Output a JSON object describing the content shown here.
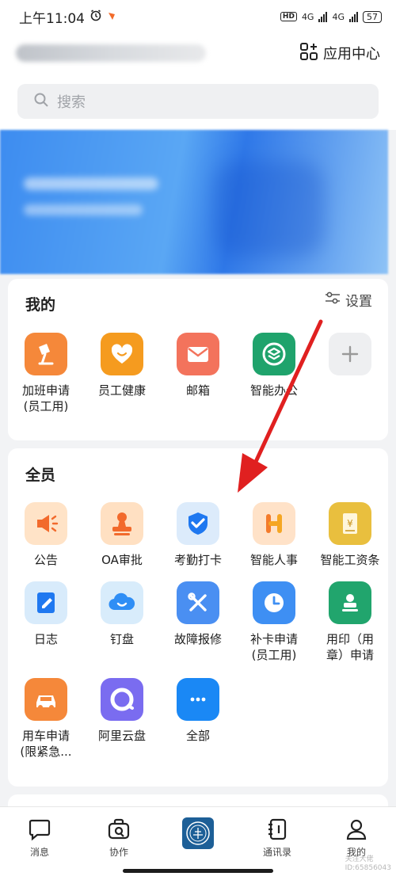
{
  "status_bar": {
    "time": "上午11:04",
    "network_1": "4G",
    "network_2": "4G",
    "hd": "HD",
    "battery": "57"
  },
  "header": {
    "app_center": "应用中心"
  },
  "search": {
    "placeholder": "搜索"
  },
  "my_section": {
    "title": "我的",
    "settings": "设置",
    "apps": [
      {
        "label": "加班申请\n(员工用)",
        "icon": "desk-lamp-icon",
        "color": "#f5883a"
      },
      {
        "label": "员工健康",
        "icon": "heart-icon",
        "color": "#f59b1f"
      },
      {
        "label": "邮箱",
        "icon": "envelope-icon",
        "color": "#f3735c"
      },
      {
        "label": "智能办公",
        "icon": "smart-office-icon",
        "color": "#1fa36c"
      },
      {
        "label": "",
        "icon": "plus-icon",
        "color": "#eeeff1"
      }
    ]
  },
  "all_section": {
    "title": "全员",
    "apps": [
      {
        "label": "公告",
        "icon": "megaphone-icon",
        "color": "#ffe3c7"
      },
      {
        "label": "OA审批",
        "icon": "stamp-icon",
        "color": "#ffe0c2"
      },
      {
        "label": "考勤打卡",
        "icon": "check-shield-icon",
        "color": "#dcebfb"
      },
      {
        "label": "智能人事",
        "icon": "h-logo-icon",
        "color": "#ffe2c8"
      },
      {
        "label": "智能工资条",
        "icon": "payslip-icon",
        "color": "#e9bf3e"
      },
      {
        "label": "日志",
        "icon": "notebook-icon",
        "color": "#d8ebfb"
      },
      {
        "label": "钉盘",
        "icon": "cloud-icon",
        "color": "#d8ecfb"
      },
      {
        "label": "故障报修",
        "icon": "tools-icon",
        "color": "#4a8ff2"
      },
      {
        "label": "补卡申请\n(员工用)",
        "icon": "clock-icon",
        "color": "#3e8ff3"
      },
      {
        "label": "用印（用\n章）申请",
        "icon": "seal-icon",
        "color": "#21a56d"
      },
      {
        "label": "用车申请\n(限紧急...",
        "icon": "car-icon",
        "color": "#f5883a"
      },
      {
        "label": "阿里云盘",
        "icon": "aliyun-drive-icon",
        "color": "#7a6cf0"
      },
      {
        "label": "全部",
        "icon": "more-icon",
        "color": "#1a88f5"
      }
    ]
  },
  "tabbar": {
    "items": [
      {
        "label": "消息",
        "icon": "message-icon"
      },
      {
        "label": "协作",
        "icon": "collab-icon"
      },
      {
        "label": "",
        "icon": "org-logo-icon"
      },
      {
        "label": "通讯录",
        "icon": "contacts-icon"
      },
      {
        "label": "我的",
        "icon": "user-icon"
      }
    ]
  },
  "watermark": {
    "line1": "关注大佬",
    "line2": "ID:65856043"
  },
  "colors": {
    "accent": "#1a88f5",
    "annotation_arrow": "#e02020"
  }
}
